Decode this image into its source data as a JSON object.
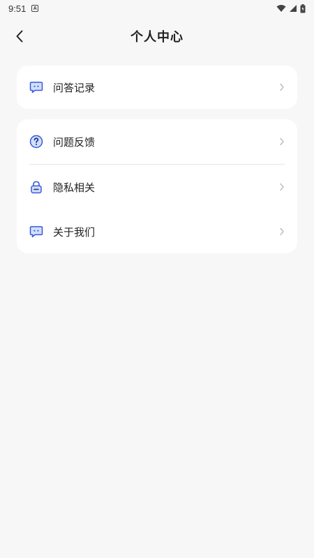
{
  "status_bar": {
    "time": "9:51",
    "notification_icon": "A"
  },
  "header": {
    "title": "个人中心"
  },
  "menu": {
    "group1": [
      {
        "label": "问答记录",
        "icon": "chat-bubble-icon"
      }
    ],
    "group2": [
      {
        "label": "问题反馈",
        "icon": "question-circle-icon"
      },
      {
        "label": "隐私相关",
        "icon": "lock-icon"
      },
      {
        "label": "关于我们",
        "icon": "chat-bubble-icon"
      }
    ]
  },
  "colors": {
    "accent": "#3b57d9",
    "icon_fill": "#cfe0ff",
    "background": "#f7f7f7",
    "card": "#ffffff"
  }
}
